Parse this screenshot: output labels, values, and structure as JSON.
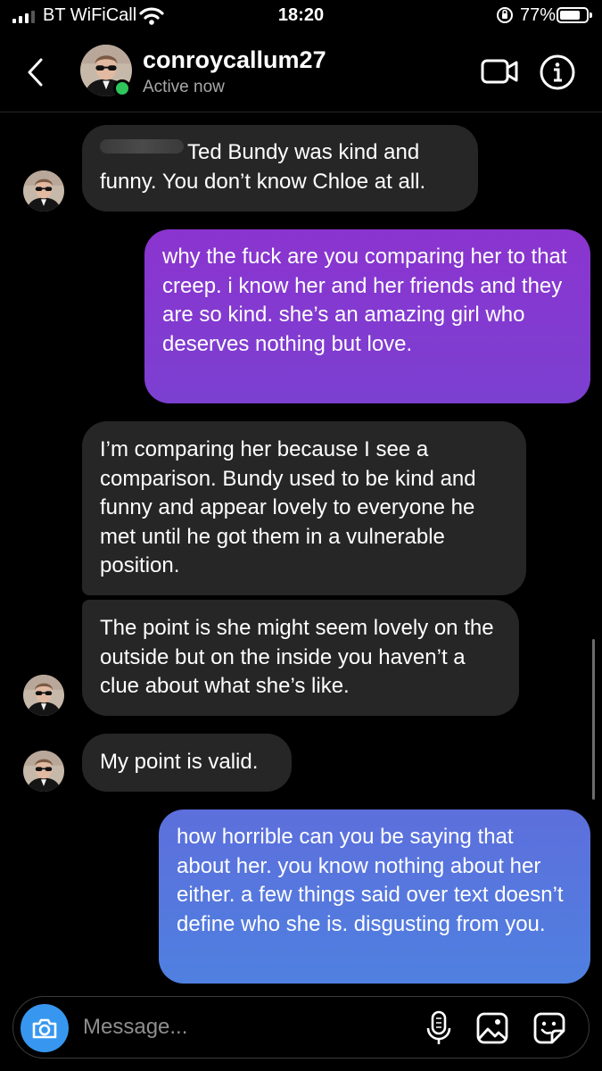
{
  "status_bar": {
    "carrier": "BT WiFiCall",
    "time": "18:20",
    "battery": "77%"
  },
  "header": {
    "contact_name": "conroycallum27",
    "contact_status": "Active now",
    "icons": [
      "back-icon",
      "video-call-icon",
      "info-icon"
    ]
  },
  "messages": [
    {
      "sender": "contact",
      "text": "Ted Bundy was kind and funny. You don’t know Chloe at all.",
      "redacted_prefix": true
    },
    {
      "sender": "me",
      "text": "why the fuck are you comparing her to that creep. i know her and her friends and they are so kind. she’s an amazing girl who deserves nothing but love."
    },
    {
      "sender": "contact",
      "text": "I’m comparing her because I see a comparison. Bundy used to be kind and funny and appear lovely to everyone he met until he got them in a vulnerable position."
    },
    {
      "sender": "contact",
      "text": "The point is she might seem lovely on the outside but on the inside you haven’t a clue about what she’s like."
    },
    {
      "sender": "contact",
      "text": "My point is valid."
    },
    {
      "sender": "me",
      "text": "how horrible can you be saying that about her. you know nothing about her either. a few things said over text doesn’t define who she is. disgusting from you."
    }
  ],
  "composer": {
    "placeholder": "Message...",
    "icons": [
      "camera-icon",
      "microphone-icon",
      "gallery-icon",
      "sticker-icon"
    ]
  },
  "colors": {
    "background": "#000000",
    "incoming_bubble": "#262626",
    "outgoing_purple": "#8a3ccc",
    "outgoing_blue": "#5b74dd",
    "active_dot": "#2fc55b",
    "camera_button": "#3797f0"
  }
}
